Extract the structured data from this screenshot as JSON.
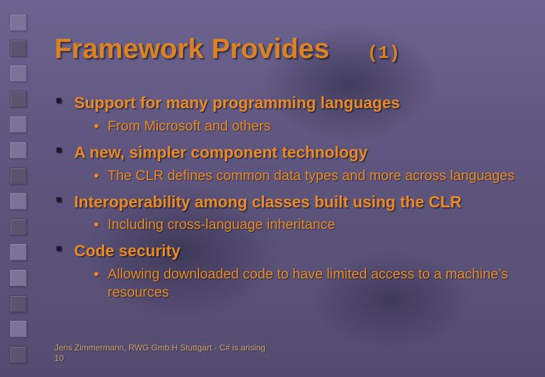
{
  "title": "Framework Provides",
  "title_num": "(1)",
  "bullets": [
    {
      "text": "Support for many programming languages",
      "sub": [
        "From Microsoft and others"
      ]
    },
    {
      "text": "A new, simpler component technology",
      "sub": [
        "The CLR defines common data types and more across languages"
      ]
    },
    {
      "text": "Interoperability among classes built using the CLR",
      "sub": [
        "Including cross-language inheritance"
      ]
    },
    {
      "text": "Code security",
      "sub": [
        "Allowing downloaded code to have limited access to a machine’s resources"
      ]
    }
  ],
  "footer_line1": "Jens Zimmermann, RWG Gmb.H Stuttgart - C# is arising",
  "footer_line2": "10"
}
